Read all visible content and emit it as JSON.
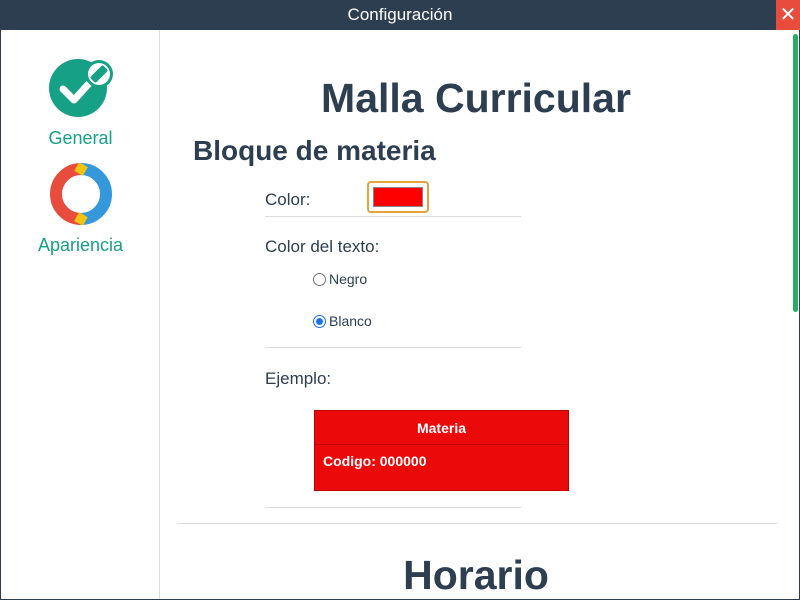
{
  "window": {
    "title": "Configuración",
    "close_label": "✕"
  },
  "sidebar": {
    "items": [
      {
        "label": "General",
        "icon": "check-pencil-icon"
      },
      {
        "label": "Apariencia",
        "icon": "color-ring-icon"
      }
    ]
  },
  "main": {
    "title": "Malla Curricular",
    "section_title": "Bloque de materia",
    "color_label": "Color:",
    "color_value": "#ff0000",
    "text_color_label": "Color del texto:",
    "text_color_options": [
      {
        "label": "Negro",
        "checked": false
      },
      {
        "label": "Blanco",
        "checked": true
      }
    ],
    "example_label": "Ejemplo:",
    "example_block": {
      "header": "Materia",
      "code": "Codigo: 000000",
      "color": "#ea0a0a"
    },
    "next_title": "Horario"
  },
  "colors": {
    "accent": "#16a085",
    "titlebar": "#2c3e50",
    "close": "#e74c3c",
    "scrollbar": "#27ae60"
  }
}
